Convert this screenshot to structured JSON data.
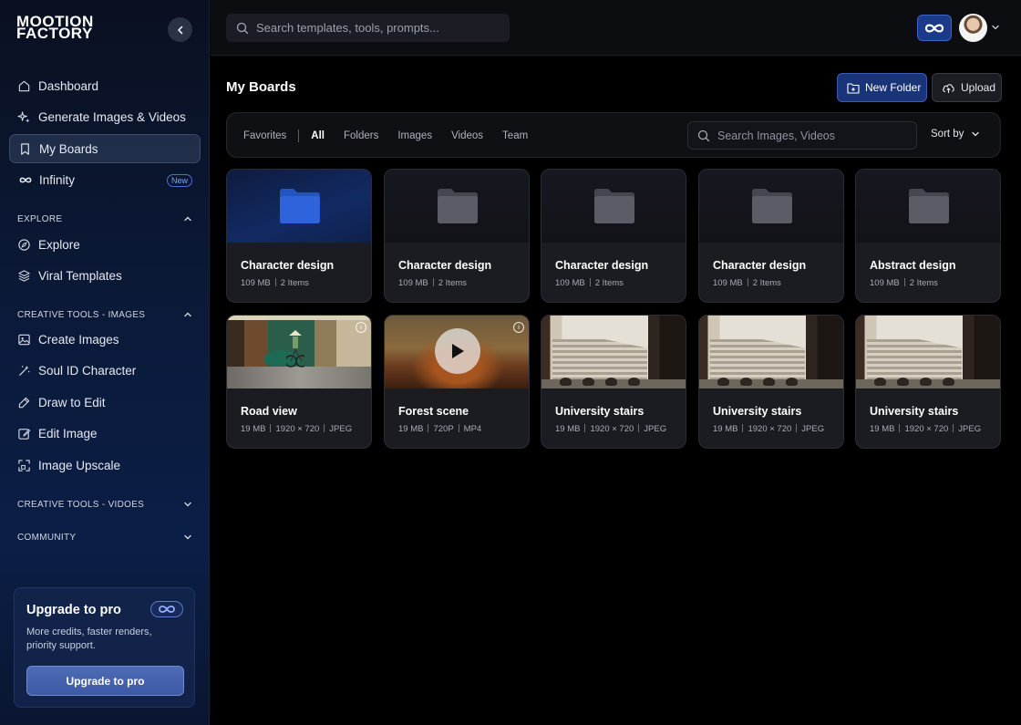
{
  "brand": {
    "line1": "MOOTION",
    "line2": "FACTORY"
  },
  "sidebar": {
    "primary": [
      {
        "label": "Dashboard",
        "icon": "home-icon"
      },
      {
        "label": "Generate Images & Videos",
        "icon": "sparkles-icon"
      },
      {
        "label": "My Boards",
        "icon": "bookmark-icon",
        "active": true
      },
      {
        "label": "Infinity",
        "icon": "infinity-icon",
        "badge": "New"
      }
    ],
    "explore": {
      "title": "EXPLORE",
      "items": [
        {
          "label": "Explore",
          "icon": "compass-icon"
        },
        {
          "label": "Viral Templates",
          "icon": "layers-icon"
        }
      ]
    },
    "images": {
      "title": "CREATIVE TOOLS - IMAGES",
      "items": [
        {
          "label": "Create Images",
          "icon": "image-icon"
        },
        {
          "label": "Soul ID Character",
          "icon": "magic-wand-icon"
        },
        {
          "label": "Draw to Edit",
          "icon": "pen-icon"
        },
        {
          "label": "Edit Image",
          "icon": "edit-icon"
        },
        {
          "label": "Image Upscale",
          "icon": "upscale-icon"
        }
      ]
    },
    "videos": {
      "title": "CREATIVE TOOLS - VIDOES"
    },
    "community": {
      "title": "COMMUNITY"
    },
    "upgrade": {
      "title": "Upgrade to pro",
      "description": "More credits, faster renders, priority support.",
      "button": "Upgrade to pro"
    }
  },
  "topbar": {
    "search_placeholder": "Search templates, tools, prompts..."
  },
  "main": {
    "title": "My Boards",
    "new_folder": "New Folder",
    "upload": "Upload",
    "filters": [
      "Favorites",
      "All",
      "Folders",
      "Images",
      "Videos",
      "Team"
    ],
    "active_filter": "All",
    "search_placeholder": "Search Images, Videos",
    "sort_label": "Sort by",
    "folders": [
      {
        "title": "Character design",
        "size": "109 MB",
        "count": "2 Items"
      },
      {
        "title": "Character design",
        "size": "109 MB",
        "count": "2 Items"
      },
      {
        "title": "Character design",
        "size": "109 MB",
        "count": "2 Items"
      },
      {
        "title": "Character design",
        "size": "109 MB",
        "count": "2 Items"
      },
      {
        "title": "Abstract design",
        "size": "109 MB",
        "count": "2 Items"
      }
    ],
    "media": [
      {
        "title": "Road view",
        "size": "19 MB",
        "res": "1920 × 720",
        "format": "JPEG"
      },
      {
        "title": "Forest scene",
        "size": "19 MB",
        "res": "720P",
        "format": "MP4"
      },
      {
        "title": "University stairs",
        "size": "19 MB",
        "res": "1920 × 720",
        "format": "JPEG"
      },
      {
        "title": "University stairs",
        "size": "19 MB",
        "res": "1920 × 720",
        "format": "JPEG"
      },
      {
        "title": "University stairs",
        "size": "19 MB",
        "res": "1920 × 720",
        "format": "JPEG"
      }
    ]
  }
}
